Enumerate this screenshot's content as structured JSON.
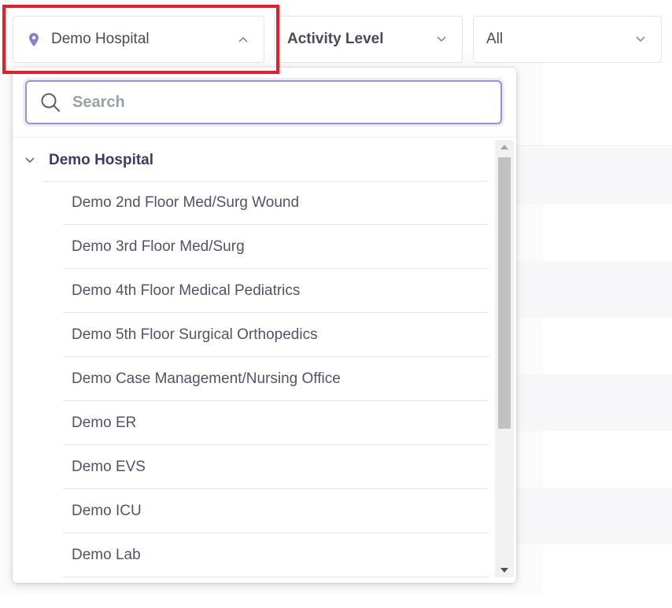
{
  "filters": {
    "location": {
      "label": "Demo Hospital",
      "icon": "map-pin-icon",
      "expanded": true
    },
    "activity": {
      "label": "Activity Level"
    },
    "status": {
      "label": "All"
    }
  },
  "dropdown": {
    "search": {
      "value": "",
      "placeholder": "Search"
    },
    "group": {
      "label": "Demo Hospital",
      "expanded": true
    },
    "items": [
      "Demo 2nd Floor Med/Surg Wound",
      "Demo 3rd Floor Med/Surg",
      "Demo 4th Floor Medical Pediatrics",
      "Demo 5th Floor Surgical Orthopedics",
      "Demo Case Management/Nursing Office",
      "Demo ER",
      "Demo EVS",
      "Demo ICU",
      "Demo Lab"
    ]
  },
  "colors": {
    "accent": "#9b8ee0",
    "pin": "#8a7ed1",
    "highlight": "#e41e2b",
    "group_text": "#3f3a6a",
    "item_text": "#55506e"
  }
}
